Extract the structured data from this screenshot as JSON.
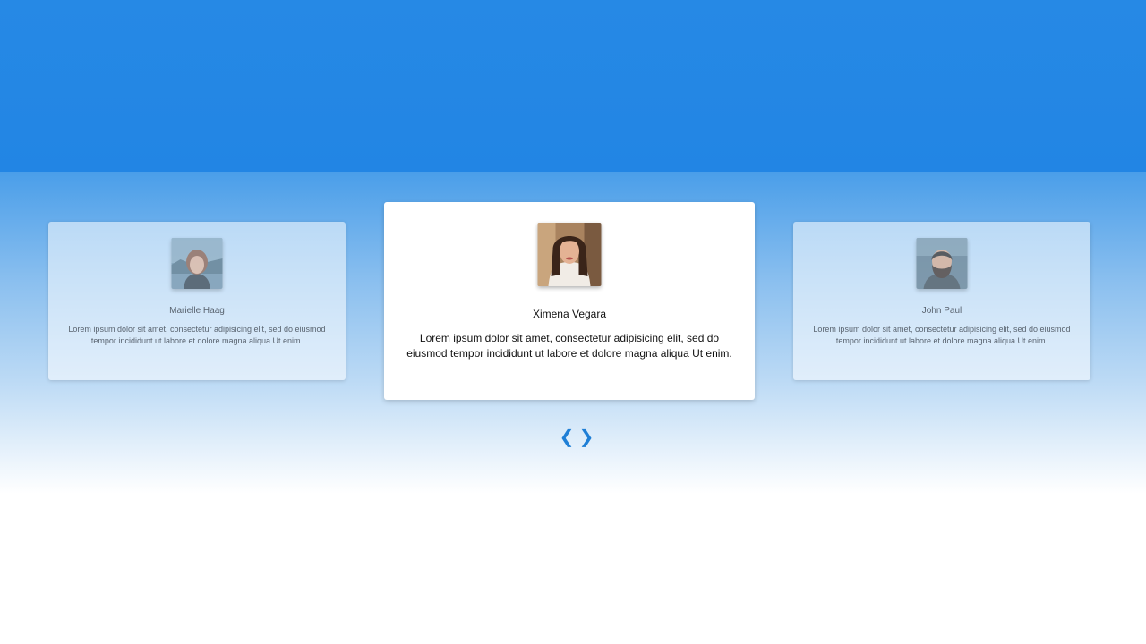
{
  "colors": {
    "hero": "#2689e5",
    "accent": "#1f7fd6"
  },
  "testimonials": [
    {
      "name": "Marielle Haag",
      "quote": "Lorem ipsum dolor sit amet, consectetur adipisicing elit, sed do eiusmod tempor incididunt ut labore et dolore magna aliqua Ut enim.",
      "state": "inactive"
    },
    {
      "name": "Ximena Vegara",
      "quote": "Lorem ipsum dolor sit amet, consectetur adipisicing elit, sed do eiusmod tempor incididunt ut labore et dolore magna aliqua Ut enim.",
      "state": "active"
    },
    {
      "name": "John Paul",
      "quote": "Lorem ipsum dolor sit amet, consectetur adipisicing elit, sed do eiusmod tempor incididunt ut labore et dolore magna aliqua Ut enim.",
      "state": "inactive"
    }
  ],
  "nav": {
    "prev_icon": "chevron-left-icon",
    "next_icon": "chevron-right-icon",
    "prev": "❮",
    "next": "❯"
  }
}
